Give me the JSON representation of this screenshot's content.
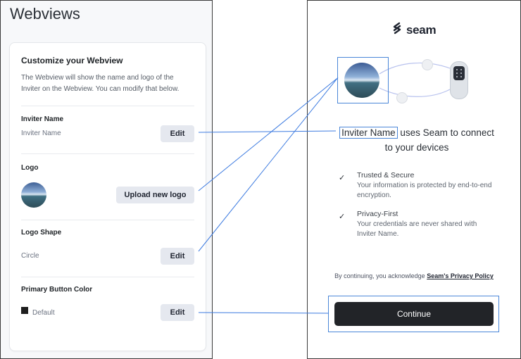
{
  "left_panel": {
    "title": "Webviews",
    "card": {
      "title": "Customize your Webview",
      "description": "The Webview will show the name and logo of the Inviter on the Webview. You can modify that below.",
      "sections": {
        "inviter_name": {
          "label": "Inviter Name",
          "value": "Inviter Name",
          "button": "Edit"
        },
        "logo": {
          "label": "Logo",
          "button": "Upload new logo"
        },
        "logo_shape": {
          "label": "Logo Shape",
          "value": "Circle",
          "button": "Edit"
        },
        "primary_color": {
          "label": "Primary Button Color",
          "value": "Default",
          "button": "Edit",
          "swatch_color": "#1f1f1f"
        }
      }
    }
  },
  "right_panel": {
    "brand": "seam",
    "headline_name": "Inviter Name",
    "headline_rest": "uses Seam to connect to your devices",
    "features": [
      {
        "title": "Trusted & Secure",
        "desc": "Your information is protected by end-to-end encryption."
      },
      {
        "title": "Privacy-First",
        "desc": "Your credentials are never shared with Inviter Name."
      }
    ],
    "consent_prefix": "By continuing, you acknowledge ",
    "consent_link": "Seam's Privacy Policy",
    "continue_label": "Continue"
  },
  "colors": {
    "accent_outline": "#4a86d8",
    "primary_button": "#222428",
    "secondary_button": "#e5e8ef"
  }
}
